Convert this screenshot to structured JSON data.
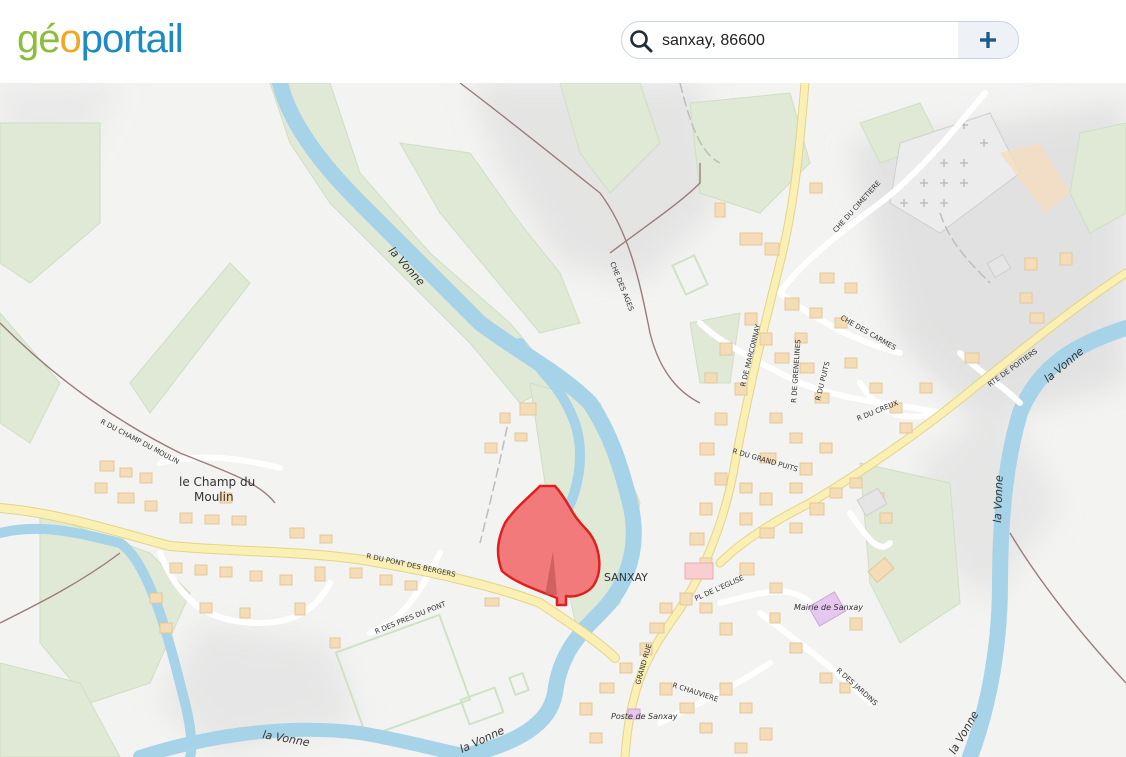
{
  "header": {
    "logo": {
      "part1": "gé",
      "part2": "o",
      "part3": "portail"
    },
    "search": {
      "value": "sanxay, 86600",
      "placeholder": ""
    },
    "add_icon": "plus-icon",
    "search_icon": "search-icon"
  },
  "colors": {
    "brand_blue": "#1a8bc6",
    "brand_green": "#8bbe3b",
    "brand_orange": "#f5a623",
    "water": "#a6d3e8",
    "road": "#fbf0b4",
    "vegetation": "#dde8d3",
    "building": "#f3dcb6",
    "marker": "#f26d6d"
  },
  "map": {
    "labels": {
      "la_vonne_1": "la Vonne",
      "la_vonne_2": "la Vonne",
      "la_vonne_3": "la Vonne",
      "la_vonne_4": "la Vonne",
      "la_vonne_5": "la Vonne",
      "la_vonne_6": "la Vonne",
      "champ_line1": "le Champ du",
      "champ_line2": "Moulin",
      "sanxay": "SANXAY",
      "mairie": "Mairie de Sanxay",
      "poste": "Poste de Sanxay",
      "r_champ_moulin": "R DU CHAMP DU MOULIN",
      "r_pont_bergers": "R DU PONT DES BERGERS",
      "r_pres_pont": "R DES PRES DU PONT",
      "che_ages": "CHE DES AGES",
      "che_cimetiere": "CHE DU CIMETIERE",
      "r_marconnay": "R DE MARCONNAY",
      "r_grenelines": "R DE GRENELINES",
      "che_carmes": "CHE DES CARMES",
      "r_puits": "R DU PUITS",
      "r_creux": "R DU CREUX",
      "rte_poitiers": "RTE DE POITIERS",
      "r_grand_puits": "R DU GRAND PUITS",
      "pl_eglise": "PL DE L'EGLISE",
      "grand_rue": "GRAND RUE",
      "r_chauviere": "R CHAUVIERE",
      "r_jardins": "R DES JARDINS"
    }
  }
}
